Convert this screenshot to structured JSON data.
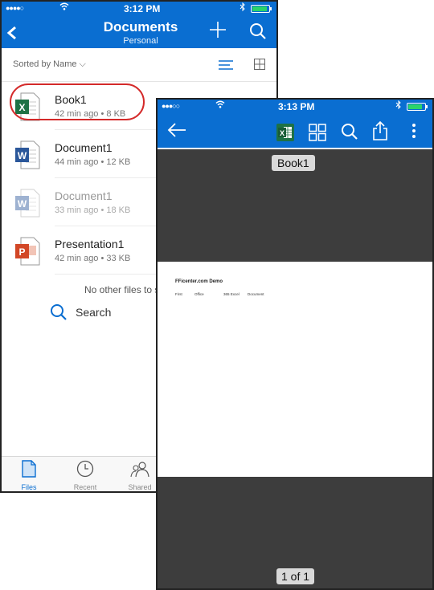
{
  "phone1": {
    "status": {
      "signal": "●●●●○",
      "time": "3:12 PM",
      "battery_level": 0.9
    },
    "header": {
      "title": "Documents",
      "subtitle": "Personal"
    },
    "sort": {
      "label": "Sorted by Name ⌵"
    },
    "files": [
      {
        "name": "Book1",
        "meta": "42 min ago • 8 KB",
        "type": "excel",
        "letter": "X",
        "color": "#1e7145"
      },
      {
        "name": "Document1",
        "meta": "44 min ago • 12 KB",
        "type": "word",
        "letter": "W",
        "color": "#2b579a"
      },
      {
        "name": "Document1",
        "meta": "33 min ago • 18 KB",
        "type": "word",
        "letter": "W",
        "color": "#2b579a"
      },
      {
        "name": "Presentation1",
        "meta": "42 min ago • 33 KB",
        "type": "powerpoint",
        "letter": "P",
        "color": "#d24726"
      }
    ],
    "empty_message": "No other files to s",
    "search_label": "Search",
    "tabs": [
      {
        "label": "Files",
        "icon": "file-icon",
        "active": true
      },
      {
        "label": "Recent",
        "icon": "clock-icon",
        "active": false
      },
      {
        "label": "Shared",
        "icon": "people-icon",
        "active": false
      }
    ]
  },
  "phone2": {
    "status": {
      "signal": "●●●○○",
      "time": "3:13 PM",
      "battery_level": 0.85
    },
    "doc_title": "Book1",
    "sheet": {
      "title": "FFicenter.com Demo",
      "cells": [
        "First",
        "Office",
        "365 Excel",
        "Document"
      ]
    },
    "page_indicator": "1 of 1"
  },
  "colors": {
    "accent": "#0a6ed1",
    "highlight": "#d42a2a",
    "viewer_bg": "#3d3d3d"
  }
}
